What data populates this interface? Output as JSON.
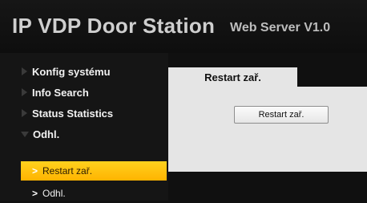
{
  "header": {
    "title": "IP VDP Door Station",
    "subtitle": "Web Server V1.0"
  },
  "sidebar": {
    "items": [
      {
        "label": "Konfig systému",
        "expanded": false
      },
      {
        "label": "Info Search",
        "expanded": false
      },
      {
        "label": "Status Statistics",
        "expanded": false
      },
      {
        "label": "Odhl.",
        "expanded": true
      }
    ],
    "subitems": [
      {
        "label": "Restart zař.",
        "active": true
      },
      {
        "label": "Odhl.",
        "active": false
      }
    ]
  },
  "main": {
    "tab_label": "Restart zař.",
    "restart_button_label": "Restart zař."
  },
  "colors": {
    "accent": "#ffc20e",
    "panel": "#e5e5e5",
    "background": "#101010"
  }
}
